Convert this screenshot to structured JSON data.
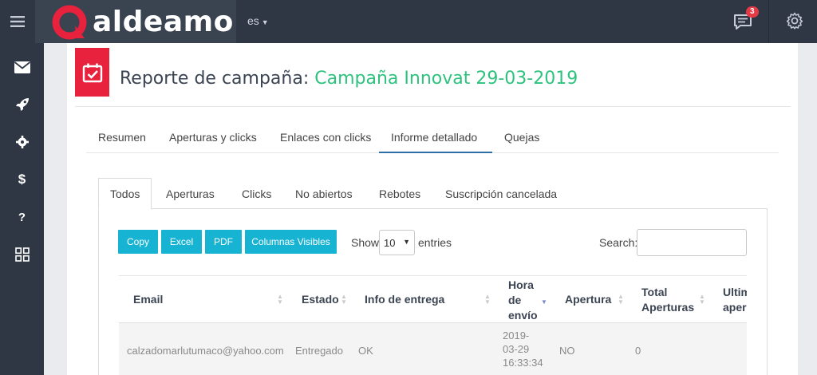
{
  "topbar": {
    "brand": "aldeamo",
    "language": "es",
    "notification_count": "3",
    "icons": [
      "menu-icon",
      "chat-icon",
      "gear-icon"
    ]
  },
  "sidebar": {
    "items": [
      {
        "icon": "envelope-icon"
      },
      {
        "icon": "rocket-icon"
      },
      {
        "icon": "gear-icon"
      },
      {
        "icon": "dollar-icon",
        "glyph": "$"
      },
      {
        "icon": "question-icon",
        "glyph": "?"
      },
      {
        "icon": "grid-icon"
      }
    ]
  },
  "header": {
    "title_prefix": "Reporte de campaña:",
    "campaign": "Campaña Innovat 29-03-2019"
  },
  "report_tabs": [
    {
      "label": "Resumen"
    },
    {
      "label": "Aperturas y clicks"
    },
    {
      "label": "Enlaces con clicks"
    },
    {
      "label": "Informe detallado",
      "active": true
    },
    {
      "label": "Quejas"
    }
  ],
  "filter_tabs": [
    {
      "label": "Todos",
      "active": true
    },
    {
      "label": "Aperturas"
    },
    {
      "label": "Clicks"
    },
    {
      "label": "No abiertos"
    },
    {
      "label": "Rebotes"
    },
    {
      "label": "Suscripción cancelada"
    }
  ],
  "toolbar": {
    "buttons": [
      "Copy",
      "Excel",
      "PDF",
      "Columnas Visibles"
    ],
    "show_label": "Show",
    "page_size": "10",
    "entries_label": "entries",
    "search_label": "Search:",
    "search_value": ""
  },
  "table": {
    "headers": {
      "email": "Email",
      "estado": "Estado",
      "info": "Info de entrega",
      "hora": [
        "Hora",
        "de",
        "envío"
      ],
      "apertura": "Apertura",
      "total": [
        "Total",
        "Aperturas"
      ],
      "ultima": [
        "Ultim",
        "aper"
      ]
    },
    "rows": [
      {
        "email": "calzadomarlutumaco@yahoo.com",
        "estado": "Entregado",
        "info": "OK",
        "hora": [
          "2019-",
          "03-29",
          "16:33:34"
        ],
        "apertura": "NO",
        "total": "0"
      }
    ]
  },
  "colors": {
    "topbar": "#2f3744",
    "accent_red": "#e8213d",
    "campaign_green": "#2ec27e",
    "button_cyan": "#17b3d3",
    "active_tab_underline": "#2f6fa8"
  }
}
